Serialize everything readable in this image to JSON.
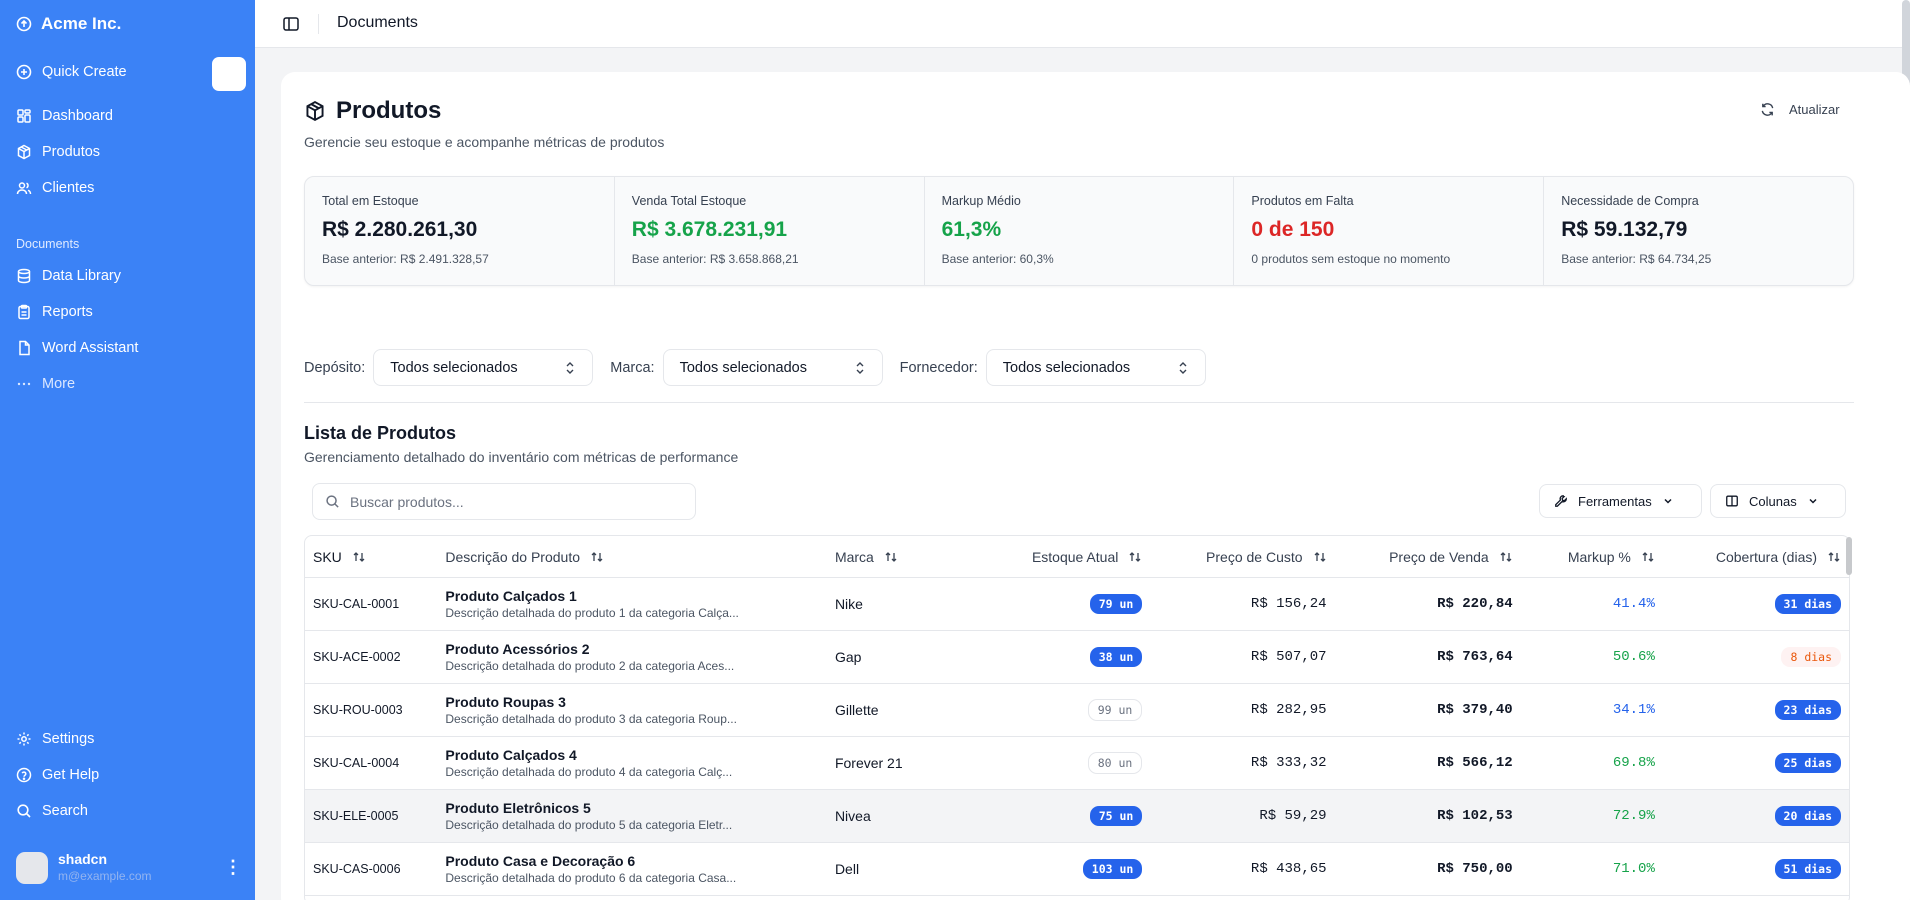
{
  "sidebar": {
    "brand": "Acme Inc.",
    "quick_create": "Quick Create",
    "items": [
      "Dashboard",
      "Produtos",
      "Clientes"
    ],
    "section": "Documents",
    "doc_items": [
      "Data Library",
      "Reports",
      "Word Assistant"
    ],
    "more": "More",
    "bottom_items": [
      "Settings",
      "Get Help",
      "Search"
    ],
    "user": {
      "name": "shadcn",
      "email": "m@example.com"
    }
  },
  "topbar": {
    "title": "Documents"
  },
  "page": {
    "title": "Produtos",
    "subtitle": "Gerencie seu estoque e acompanhe métricas de produtos",
    "refresh": "Atualizar"
  },
  "metrics": [
    {
      "label": "Total em Estoque",
      "value": "R$ 2.280.261,30",
      "sub": "Base anterior: R$ 2.491.328,57",
      "color": "#111827"
    },
    {
      "label": "Venda Total Estoque",
      "value": "R$ 3.678.231,91",
      "sub": "Base anterior: R$ 3.658.868,21",
      "color": "#16a34a"
    },
    {
      "label": "Markup Médio",
      "value": "61,3%",
      "sub": "Base anterior: 60,3%",
      "color": "#16a34a"
    },
    {
      "label": "Produtos em Falta",
      "value": "0 de 150",
      "sub": "0 produtos sem estoque no momento",
      "color": "#dc2626"
    },
    {
      "label": "Necessidade de Compra",
      "value": "R$ 59.132,79",
      "sub": "Base anterior: R$ 64.734,25",
      "color": "#111827"
    }
  ],
  "filters": [
    {
      "label": "Depósito:",
      "value": "Todos selecionados"
    },
    {
      "label": "Marca:",
      "value": "Todos selecionados"
    },
    {
      "label": "Fornecedor:",
      "value": "Todos selecionados"
    }
  ],
  "list": {
    "title": "Lista de Produtos",
    "subtitle": "Gerenciamento detalhado do inventário com métricas de performance",
    "search_placeholder": "Buscar produtos...",
    "tools_label": "Ferramentas",
    "columns_label": "Colunas"
  },
  "table": {
    "headers": [
      "SKU",
      "Descrição do Produto",
      "Marca",
      "Estoque Atual",
      "Preço de Custo",
      "Preço de Venda",
      "Markup %",
      "Cobertura (dias)"
    ],
    "rows": [
      {
        "sku": "SKU-CAL-0001",
        "name": "Produto Calçados 1",
        "desc": "Descrição detalhada do produto 1 da categoria Calça...",
        "brand": "Nike",
        "stock": "79 un",
        "stock_style": "solid",
        "cost": "R$ 156,24",
        "sale": "R$ 220,84",
        "markup": "41.4%",
        "markup_color": "#2563eb",
        "cov": "31 dias",
        "cov_style": "solid"
      },
      {
        "sku": "SKU-ACE-0002",
        "name": "Produto Acessórios 2",
        "desc": "Descrição detalhada do produto 2 da categoria Aces...",
        "brand": "Gap",
        "stock": "38 un",
        "stock_style": "solid",
        "cost": "R$ 507,07",
        "sale": "R$ 763,64",
        "markup": "50.6%",
        "markup_color": "#16a34a",
        "cov": "8 dias",
        "cov_style": "warn"
      },
      {
        "sku": "SKU-ROU-0003",
        "name": "Produto Roupas 3",
        "desc": "Descrição detalhada do produto 3 da categoria Roup...",
        "brand": "Gillette",
        "stock": "99 un",
        "stock_style": "outline",
        "cost": "R$ 282,95",
        "sale": "R$ 379,40",
        "markup": "34.1%",
        "markup_color": "#2563eb",
        "cov": "23 dias",
        "cov_style": "solid"
      },
      {
        "sku": "SKU-CAL-0004",
        "name": "Produto Calçados 4",
        "desc": "Descrição detalhada do produto 4 da categoria Calç...",
        "brand": "Forever 21",
        "stock": "80 un",
        "stock_style": "outline",
        "cost": "R$ 333,32",
        "sale": "R$ 566,12",
        "markup": "69.8%",
        "markup_color": "#16a34a",
        "cov": "25 dias",
        "cov_style": "solid"
      },
      {
        "sku": "SKU-ELE-0005",
        "name": "Produto Eletrônicos 5",
        "desc": "Descrição detalhada do produto 5 da categoria Eletr...",
        "brand": "Nivea",
        "stock": "75 un",
        "stock_style": "solid",
        "cost": "R$ 59,29",
        "sale": "R$ 102,53",
        "markup": "72.9%",
        "markup_color": "#16a34a",
        "cov": "20 dias",
        "cov_style": "solid"
      },
      {
        "sku": "SKU-CAS-0006",
        "name": "Produto Casa e Decoração 6",
        "desc": "Descrição detalhada do produto 6 da categoria Casa...",
        "brand": "Dell",
        "stock": "103 un",
        "stock_style": "solid",
        "cost": "R$ 438,65",
        "sale": "R$ 750,00",
        "markup": "71.0%",
        "markup_color": "#16a34a",
        "cov": "51 dias",
        "cov_style": "solid"
      }
    ]
  }
}
